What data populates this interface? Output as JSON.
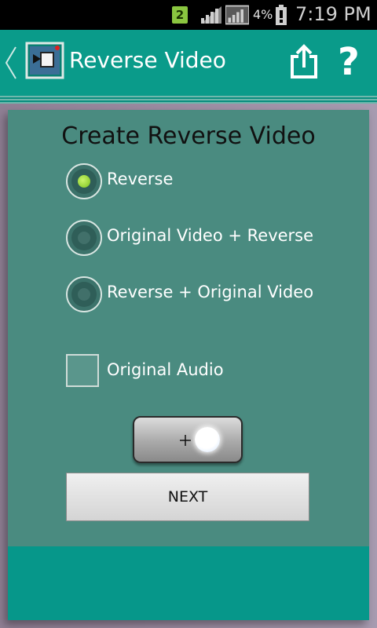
{
  "status_bar": {
    "notification_badge": "2",
    "battery_percent": "4%",
    "time": "7:19 PM",
    "icons": [
      "signal-icon",
      "signal-icon",
      "battery-low-icon"
    ]
  },
  "action_bar": {
    "title": "Reverse Video",
    "icons": [
      "back-chevron-icon",
      "app-icon",
      "share-icon",
      "help-icon"
    ],
    "help_glyph": "?"
  },
  "main": {
    "heading": "Create Reverse Video",
    "options": [
      {
        "label": "Reverse",
        "selected": true
      },
      {
        "label": "Original Video + Reverse",
        "selected": false
      },
      {
        "label": "Reverse + Original Video",
        "selected": false
      }
    ],
    "audio_checkbox": {
      "label": "Original Audio",
      "checked": false
    },
    "next_label": "NEXT"
  },
  "colors": {
    "accent": "#0a9b8a",
    "card": "#4a8b80",
    "radio_selected": "#7cc21e"
  }
}
